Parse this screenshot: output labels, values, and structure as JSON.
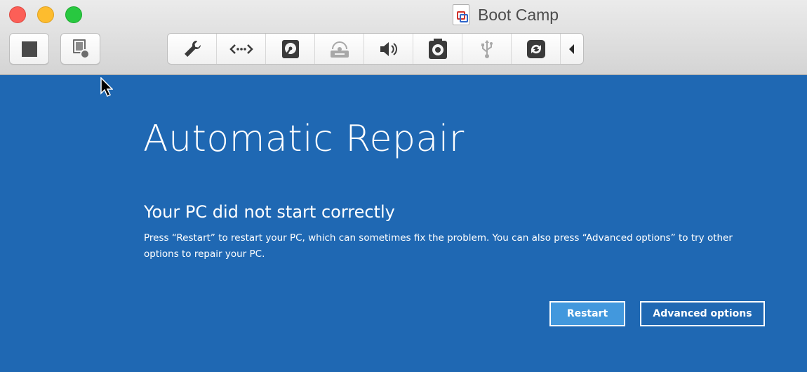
{
  "window": {
    "title": "Boot Camp",
    "traffic_lights": {
      "close": "#fc5f57",
      "minimize": "#fdbc2e",
      "zoom": "#28c840"
    }
  },
  "toolbar": {
    "left_buttons": [
      {
        "name": "stop-icon"
      },
      {
        "name": "snapshot-icon"
      }
    ],
    "devices": [
      {
        "name": "wrench-icon",
        "state": "enabled"
      },
      {
        "name": "network-icon",
        "state": "enabled"
      },
      {
        "name": "hard-disk-icon",
        "state": "enabled"
      },
      {
        "name": "optical-drive-icon",
        "state": "disabled"
      },
      {
        "name": "sound-icon",
        "state": "enabled"
      },
      {
        "name": "camera-icon",
        "state": "enabled"
      },
      {
        "name": "usb-icon",
        "state": "disabled"
      },
      {
        "name": "shared-folders-icon",
        "state": "enabled"
      },
      {
        "name": "collapse-arrow-icon",
        "state": "enabled"
      }
    ]
  },
  "screen": {
    "background": "#1f68b3",
    "title": "Automatic Repair",
    "subtitle": "Your PC did not start correctly",
    "message": "Press “Restart” to restart your PC, which can sometimes fix the problem. You can also press “Advanced options” to try other options to repair your PC.",
    "buttons": {
      "restart": "Restart",
      "advanced": "Advanced options"
    }
  }
}
